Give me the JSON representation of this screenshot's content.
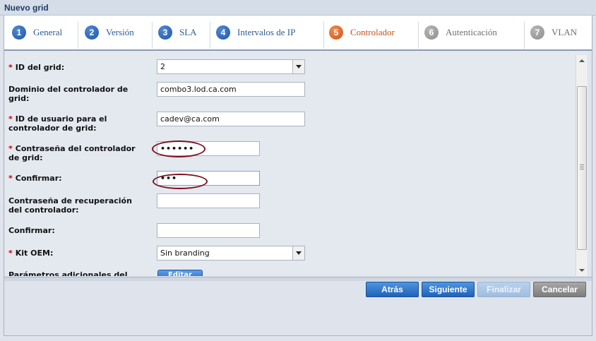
{
  "window": {
    "title": "Nuevo grid"
  },
  "tabs": [
    {
      "num": "1",
      "label": "General"
    },
    {
      "num": "2",
      "label": "Versión"
    },
    {
      "num": "3",
      "label": "SLA"
    },
    {
      "num": "4",
      "label": "Intervalos de IP"
    },
    {
      "num": "5",
      "label": "Controlador"
    },
    {
      "num": "6",
      "label": "Autenticación"
    },
    {
      "num": "7",
      "label": "VLAN"
    }
  ],
  "form": {
    "required_marker": "*",
    "grid_id": {
      "label": "ID del grid:",
      "value": "2"
    },
    "controller_domain": {
      "label_line1": "Dominio del controlador de",
      "label_line2": "grid:",
      "value": "combo3.lod.ca.com"
    },
    "controller_user_id": {
      "label_line1": "ID de usuario para el",
      "label_line2": "controlador de grid:",
      "value": "cadev@ca.com"
    },
    "controller_password": {
      "label_line1": "Contraseña del controlador",
      "label_line2": "de grid:",
      "value": "••••••"
    },
    "confirm_password": {
      "label": "Confirmar:",
      "value": "•••"
    },
    "recovery_password": {
      "label_line1": "Contraseña de recuperación",
      "label_line2": "del controlador:",
      "value": ""
    },
    "confirm_recovery": {
      "label": "Confirmar:",
      "value": ""
    },
    "oem_kit": {
      "label": "Kit OEM:",
      "value": "Sin branding"
    },
    "extra_params": {
      "label": "Parámetros adicionales del",
      "button": "Editar"
    }
  },
  "buttons": {
    "back": "Atrás",
    "next": "Siguiente",
    "finish": "Finalizar",
    "cancel": "Cancelar"
  }
}
